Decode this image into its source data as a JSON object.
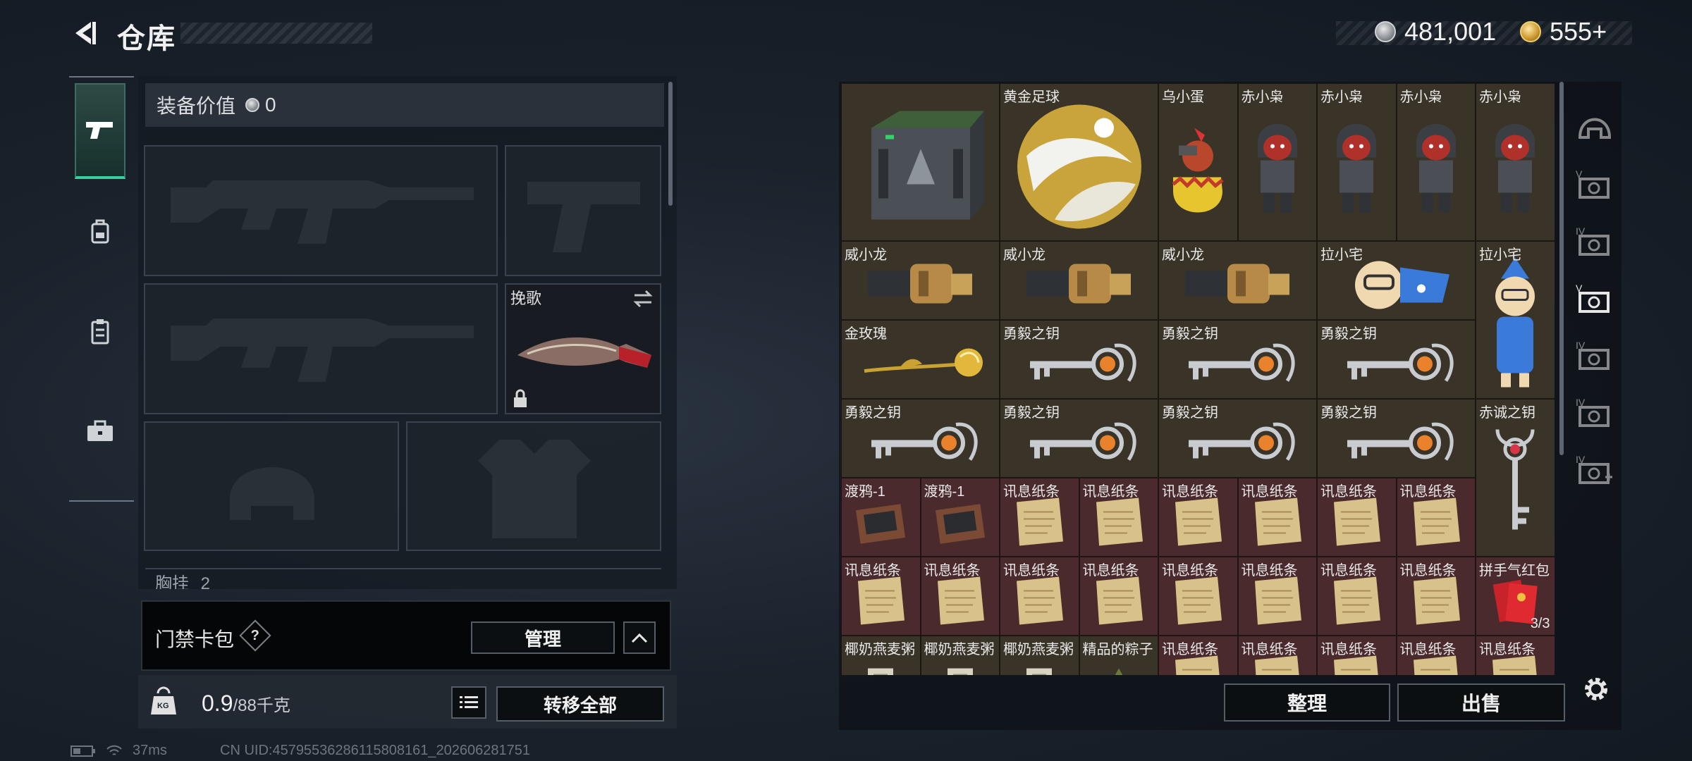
{
  "header": {
    "title": "仓库",
    "currency": [
      {
        "icon": "silver-coin-icon",
        "value": "481,001"
      },
      {
        "icon": "gold-triangle-coin-icon",
        "value": "555+"
      }
    ]
  },
  "categories": [
    {
      "name": "weapons",
      "icon": "pistol-icon",
      "active": true
    },
    {
      "name": "backpack",
      "icon": "backpack-icon",
      "active": false
    },
    {
      "name": "clipboard",
      "icon": "clipboard-icon",
      "active": false
    },
    {
      "name": "briefcase",
      "icon": "briefcase-icon",
      "active": false
    }
  ],
  "loadout": {
    "equip_value_label": "装备价值",
    "equip_value": "0",
    "melee_name": "挽歌",
    "partial_label": "胸挂",
    "partial_count": "2"
  },
  "card_wallet": {
    "label": "门禁卡包",
    "help": "?",
    "manage": "管理"
  },
  "weight": {
    "current": "0.9",
    "max": "/88千克",
    "transfer_all": "转移全部",
    "icon_text": "KG"
  },
  "status": {
    "ping": "37ms",
    "uid": "CN UID:45795536286115808161_202606281751"
  },
  "storage": {
    "sort": "整理",
    "sell": "出售",
    "items": [
      {
        "name": "",
        "col": 0,
        "row": 0,
        "w": 2,
        "h": 2,
        "red": false,
        "icon": "case"
      },
      {
        "name": "黄金足球",
        "col": 2,
        "row": 0,
        "w": 2,
        "h": 2,
        "red": false,
        "icon": "ball"
      },
      {
        "name": "乌小蛋",
        "col": 4,
        "row": 0,
        "w": 1,
        "h": 2,
        "red": false,
        "icon": "egg"
      },
      {
        "name": "赤小枭",
        "col": 5,
        "row": 0,
        "w": 1,
        "h": 2,
        "red": false,
        "icon": "figure"
      },
      {
        "name": "赤小枭",
        "col": 6,
        "row": 0,
        "w": 1,
        "h": 2,
        "red": false,
        "icon": "figure"
      },
      {
        "name": "赤小枭",
        "col": 7,
        "row": 0,
        "w": 1,
        "h": 2,
        "red": false,
        "icon": "figure"
      },
      {
        "name": "赤小枭",
        "col": 8,
        "row": 0,
        "w": 1,
        "h": 2,
        "red": false,
        "icon": "figure"
      },
      {
        "name": "威小龙",
        "col": 0,
        "row": 2,
        "w": 2,
        "h": 1,
        "red": false,
        "icon": "dragon"
      },
      {
        "name": "威小龙",
        "col": 2,
        "row": 2,
        "w": 2,
        "h": 1,
        "red": false,
        "icon": "dragon"
      },
      {
        "name": "威小龙",
        "col": 4,
        "row": 2,
        "w": 2,
        "h": 1,
        "red": false,
        "icon": "dragon"
      },
      {
        "name": "拉小宅",
        "col": 6,
        "row": 2,
        "w": 2,
        "h": 1,
        "red": false,
        "icon": "plush"
      },
      {
        "name": "拉小宅",
        "col": 8,
        "row": 2,
        "w": 1,
        "h": 2,
        "red": false,
        "icon": "plush"
      },
      {
        "name": "金玫瑰",
        "col": 0,
        "row": 3,
        "w": 2,
        "h": 1,
        "red": false,
        "icon": "rose"
      },
      {
        "name": "勇毅之钥",
        "col": 2,
        "row": 3,
        "w": 2,
        "h": 1,
        "red": false,
        "icon": "key"
      },
      {
        "name": "勇毅之钥",
        "col": 4,
        "row": 3,
        "w": 2,
        "h": 1,
        "red": false,
        "icon": "key"
      },
      {
        "name": "勇毅之钥",
        "col": 6,
        "row": 3,
        "w": 2,
        "h": 1,
        "red": false,
        "icon": "key"
      },
      {
        "name": "勇毅之钥",
        "col": 0,
        "row": 4,
        "w": 2,
        "h": 1,
        "red": false,
        "icon": "key"
      },
      {
        "name": "勇毅之钥",
        "col": 2,
        "row": 4,
        "w": 2,
        "h": 1,
        "red": false,
        "icon": "key"
      },
      {
        "name": "勇毅之钥",
        "col": 4,
        "row": 4,
        "w": 2,
        "h": 1,
        "red": false,
        "icon": "key"
      },
      {
        "name": "勇毅之钥",
        "col": 6,
        "row": 4,
        "w": 2,
        "h": 1,
        "red": false,
        "icon": "key"
      },
      {
        "name": "赤诚之钥",
        "col": 8,
        "row": 4,
        "w": 1,
        "h": 2,
        "red": false,
        "icon": "vkey"
      },
      {
        "name": "渡鸦-1",
        "col": 0,
        "row": 5,
        "w": 1,
        "h": 1,
        "red": true,
        "icon": "drive"
      },
      {
        "name": "渡鸦-1",
        "col": 1,
        "row": 5,
        "w": 1,
        "h": 1,
        "red": true,
        "icon": "drive"
      },
      {
        "name": "讯息纸条",
        "col": 2,
        "row": 5,
        "w": 1,
        "h": 1,
        "red": true,
        "icon": "paper"
      },
      {
        "name": "讯息纸条",
        "col": 3,
        "row": 5,
        "w": 1,
        "h": 1,
        "red": true,
        "icon": "paper"
      },
      {
        "name": "讯息纸条",
        "col": 4,
        "row": 5,
        "w": 1,
        "h": 1,
        "red": true,
        "icon": "paper"
      },
      {
        "name": "讯息纸条",
        "col": 5,
        "row": 5,
        "w": 1,
        "h": 1,
        "red": true,
        "icon": "paper"
      },
      {
        "name": "讯息纸条",
        "col": 6,
        "row": 5,
        "w": 1,
        "h": 1,
        "red": true,
        "icon": "paper"
      },
      {
        "name": "讯息纸条",
        "col": 7,
        "row": 5,
        "w": 1,
        "h": 1,
        "red": true,
        "icon": "paper"
      },
      {
        "name": "讯息纸条",
        "col": 0,
        "row": 6,
        "w": 1,
        "h": 1,
        "red": true,
        "icon": "paper"
      },
      {
        "name": "讯息纸条",
        "col": 1,
        "row": 6,
        "w": 1,
        "h": 1,
        "red": true,
        "icon": "paper"
      },
      {
        "name": "讯息纸条",
        "col": 2,
        "row": 6,
        "w": 1,
        "h": 1,
        "red": true,
        "icon": "paper"
      },
      {
        "name": "讯息纸条",
        "col": 3,
        "row": 6,
        "w": 1,
        "h": 1,
        "red": true,
        "icon": "paper"
      },
      {
        "name": "讯息纸条",
        "col": 4,
        "row": 6,
        "w": 1,
        "h": 1,
        "red": true,
        "icon": "paper"
      },
      {
        "name": "讯息纸条",
        "col": 5,
        "row": 6,
        "w": 1,
        "h": 1,
        "red": true,
        "icon": "paper"
      },
      {
        "name": "讯息纸条",
        "col": 6,
        "row": 6,
        "w": 1,
        "h": 1,
        "red": true,
        "icon": "paper"
      },
      {
        "name": "讯息纸条",
        "col": 7,
        "row": 6,
        "w": 1,
        "h": 1,
        "red": true,
        "icon": "paper"
      },
      {
        "name": "拼手气红包",
        "col": 8,
        "row": 6,
        "w": 1,
        "h": 1,
        "red": true,
        "icon": "envelope",
        "count": "3/3"
      },
      {
        "name": "椰奶燕麦粥",
        "col": 0,
        "row": 7,
        "w": 1,
        "h": 1,
        "red": false,
        "icon": "can"
      },
      {
        "name": "椰奶燕麦粥",
        "col": 1,
        "row": 7,
        "w": 1,
        "h": 1,
        "red": false,
        "icon": "can"
      },
      {
        "name": "椰奶燕麦粥",
        "col": 2,
        "row": 7,
        "w": 1,
        "h": 1,
        "red": false,
        "icon": "can"
      },
      {
        "name": "精品的粽子",
        "col": 3,
        "row": 7,
        "w": 1,
        "h": 1,
        "red": false,
        "icon": "zongzi"
      },
      {
        "name": "讯息纸条",
        "col": 4,
        "row": 7,
        "w": 1,
        "h": 1,
        "red": true,
        "icon": "paper"
      },
      {
        "name": "讯息纸条",
        "col": 5,
        "row": 7,
        "w": 1,
        "h": 1,
        "red": true,
        "icon": "paper"
      },
      {
        "name": "讯息纸条",
        "col": 6,
        "row": 7,
        "w": 1,
        "h": 1,
        "red": true,
        "icon": "paper"
      },
      {
        "name": "讯息纸条",
        "col": 7,
        "row": 7,
        "w": 1,
        "h": 1,
        "red": true,
        "icon": "paper"
      },
      {
        "name": "讯息纸条",
        "col": 8,
        "row": 7,
        "w": 1,
        "h": 1,
        "red": true,
        "icon": "paper"
      }
    ]
  },
  "right_rail": [
    {
      "name": "helmet",
      "icon": "helmet-icon",
      "label": "",
      "selected": false
    },
    {
      "name": "storage-v-1",
      "icon": "storage-v-icon",
      "label": "V",
      "selected": false
    },
    {
      "name": "storage-iv-1",
      "icon": "storage-iv-icon",
      "label": "IV",
      "selected": false
    },
    {
      "name": "storage-v-2",
      "icon": "storage-v-icon",
      "label": "V",
      "selected": true
    },
    {
      "name": "storage-iv-2",
      "icon": "storage-iv-icon",
      "label": "IV",
      "selected": false
    },
    {
      "name": "storage-iv-3",
      "icon": "storage-iv-icon",
      "label": "IV",
      "selected": false
    },
    {
      "name": "storage-iv-add",
      "icon": "storage-iv-add-icon",
      "label": "IV",
      "selected": false
    }
  ]
}
